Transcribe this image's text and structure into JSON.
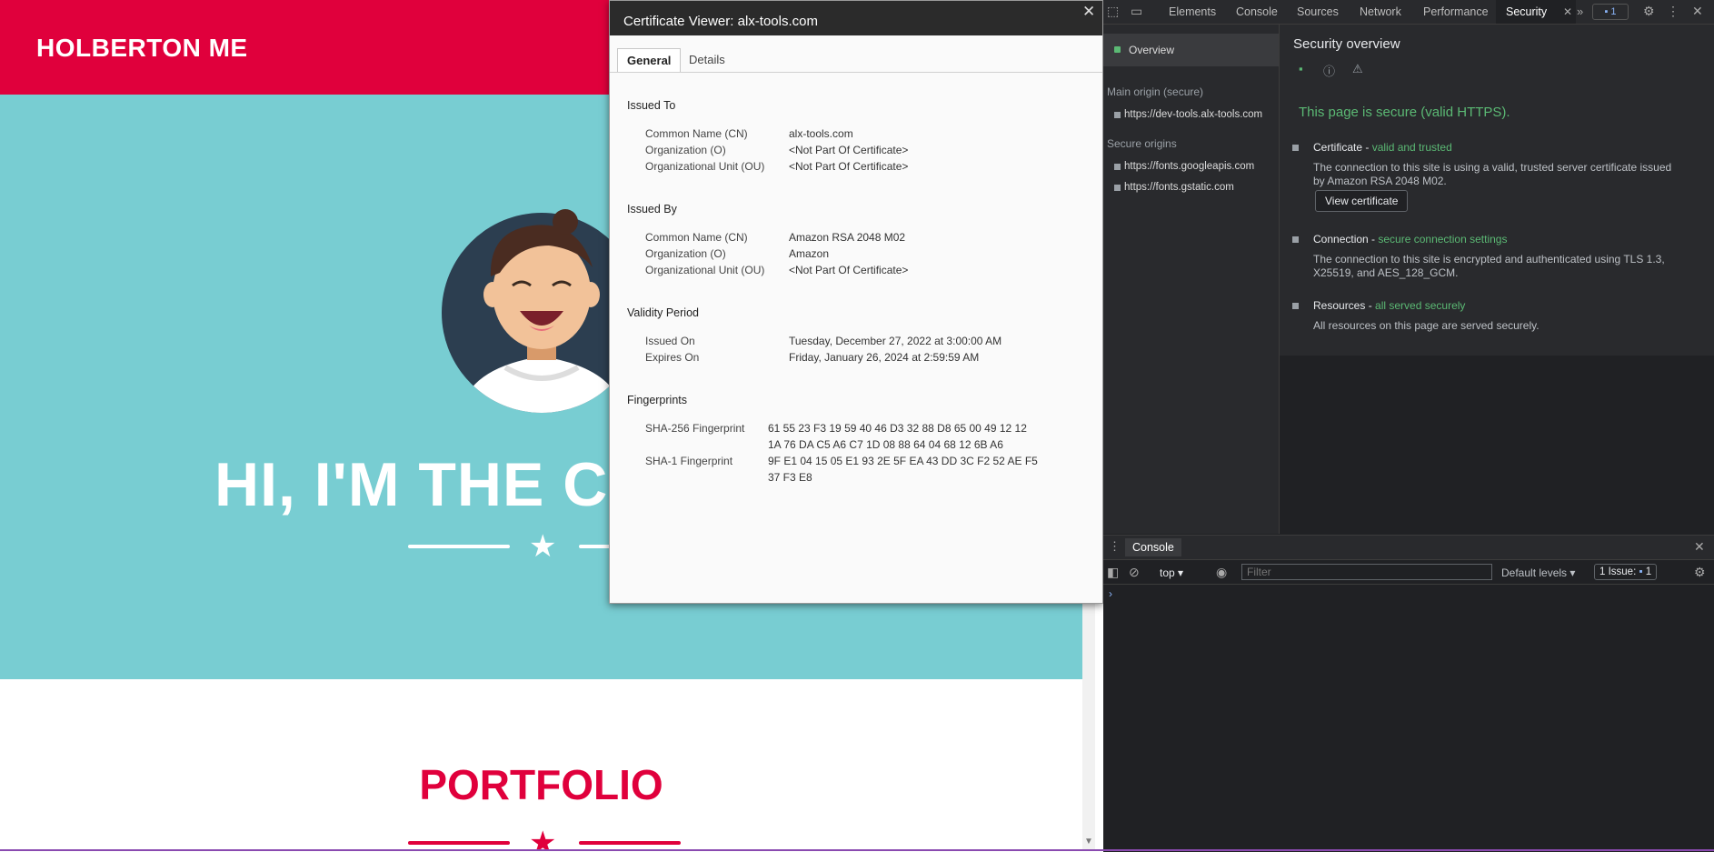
{
  "site": {
    "brand": "HOLBERTON ME",
    "hero_title": "HI, I'M THE CI",
    "portfolio_title": "PORTFOLIO"
  },
  "certificate_viewer": {
    "title": "Certificate Viewer: alx-tools.com",
    "tabs": [
      "General",
      "Details"
    ],
    "issued_to": {
      "heading": "Issued To",
      "fields": [
        {
          "label": "Common Name (CN)",
          "value": "alx-tools.com"
        },
        {
          "label": "Organization (O)",
          "value": "<Not Part Of Certificate>"
        },
        {
          "label": "Organizational Unit (OU)",
          "value": "<Not Part Of Certificate>"
        }
      ]
    },
    "issued_by": {
      "heading": "Issued By",
      "fields": [
        {
          "label": "Common Name (CN)",
          "value": "Amazon RSA 2048 M02"
        },
        {
          "label": "Organization (O)",
          "value": "Amazon"
        },
        {
          "label": "Organizational Unit (OU)",
          "value": "<Not Part Of Certificate>"
        }
      ]
    },
    "validity": {
      "heading": "Validity Period",
      "fields": [
        {
          "label": "Issued On",
          "value": "Tuesday, December 27, 2022 at 3:00:00 AM"
        },
        {
          "label": "Expires On",
          "value": "Friday, January 26, 2024 at 2:59:59 AM"
        }
      ]
    },
    "fingerprints": {
      "heading": "Fingerprints",
      "fields": [
        {
          "label": "SHA-256 Fingerprint",
          "value": "61 55 23 F3 19 59 40 46 D3 32 88 D8 65 00 49 12 12 1A 76 DA C5 A6 C7 1D 08 88 64 04 68 12 6B A6"
        },
        {
          "label": "SHA-1 Fingerprint",
          "value": "9F E1 04 15 05 E1 93 2E 5F EA 43 DD 3C F2 52 AE F5 37 F3 E8"
        }
      ]
    }
  },
  "devtools": {
    "tabs": [
      "Elements",
      "Console",
      "Sources",
      "Network",
      "Performance",
      "Security"
    ],
    "active_tab": "Security",
    "issues_badge": "1",
    "sidebar": {
      "overview": "Overview",
      "main_origin_heading": "Main origin (secure)",
      "main_origin": "https://dev-tools.alx-tools.com",
      "secure_origins_heading": "Secure origins",
      "secure_origins": [
        "https://fonts.googleapis.com",
        "https://fonts.gstatic.com"
      ]
    },
    "security": {
      "title": "Security overview",
      "secure_message": "This page is secure (valid HTTPS).",
      "certificate_title": "Certificate - ",
      "certificate_status": "valid and trusted",
      "certificate_desc": "The connection to this site is using a valid, trusted server certificate issued by Amazon RSA 2048 M02.",
      "view_certificate": "View certificate",
      "connection_title": "Connection - ",
      "connection_status": "secure connection settings",
      "connection_desc": "The connection to this site is encrypted and authenticated using TLS 1.3, X25519, and AES_128_GCM.",
      "resources_title": "Resources - ",
      "resources_status": "all served securely",
      "resources_desc": "All resources on this page are served securely."
    },
    "drawer": {
      "tab": "Console",
      "context": "top",
      "filter_placeholder": "Filter",
      "levels": "Default levels",
      "issues_label": "1 Issue:",
      "issues_count": "1"
    }
  }
}
